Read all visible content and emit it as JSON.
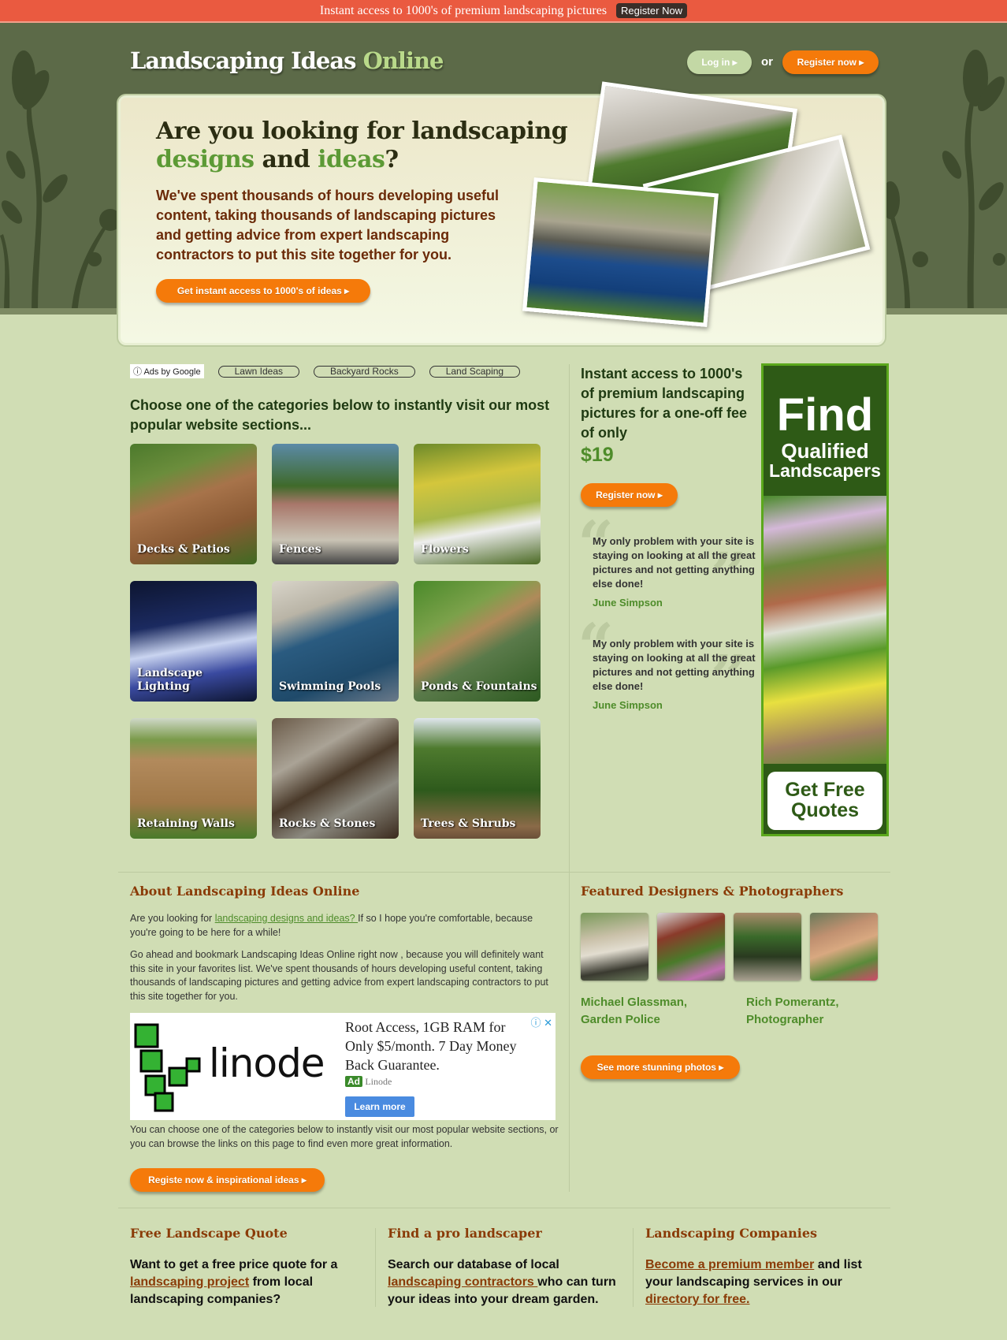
{
  "topbar": {
    "message": "Instant access to 1000's of premium landscaping pictures",
    "register": "Register Now"
  },
  "header": {
    "logo_main": "Landscaping Ideas ",
    "logo_accent": "Online",
    "login": "Log in",
    "or": "or",
    "register": "Register now"
  },
  "hero": {
    "h1_part1": "Are you looking for landscaping ",
    "h1_green1": "designs",
    "h1_and": " and ",
    "h1_green2": "ideas",
    "h1_q": "?",
    "paragraph": "We've spent thousands of hours developing useful content, taking thousands of landscaping pictures and getting advice from expert landscaping contractors to put this site together for you.",
    "cta": "Get instant access to 1000's of ideas"
  },
  "ads": {
    "label": "Ads by Google",
    "links": [
      "Lawn Ideas",
      "Backyard Rocks",
      "Land Scaping"
    ]
  },
  "categories": {
    "heading": "Choose one of the categories below to instantly visit our most popular website sections...",
    "items": [
      "Decks & Patios",
      "Fences",
      "Flowers",
      "Landscape Lighting",
      "Swimming Pools",
      "Ponds & Fountains",
      "Retaining Walls",
      "Rocks & Stones",
      "Trees & Shrubs"
    ]
  },
  "offer": {
    "text": "Instant access to 1000's of premium landscaping pictures for a one-off fee of only",
    "price": "$19",
    "register": "Register now"
  },
  "testimonials": [
    {
      "quote": "My only problem with your site is staying on looking at all the great pictures and not getting anything else done!",
      "name": "June Simpson"
    },
    {
      "quote": "My only problem with your site is staying on looking at all the great pictures and not getting anything else done!",
      "name": "June Simpson"
    }
  ],
  "banner": {
    "find": "Find",
    "qualified": "Qualified",
    "landscapers": "Landscapers",
    "quotes1": "Get Free",
    "quotes2": "Quotes"
  },
  "about": {
    "title": "About Landscaping Ideas Online",
    "p1_before": "Are you looking for ",
    "p1_link": "landscaping designs and ideas? ",
    "p1_after": "If so I hope you're comfortable, because you're going to be here for a while!",
    "p2": "Go ahead and bookmark Landscaping Ideas Online right now , because you will definitely want this site in your favorites list. We've spent thousands of hours developing useful content, taking thousands of landscaping pictures and getting advice from expert landscaping contractors to put this site together for you.",
    "p3": "You can choose one of the categories below to instantly visit our most popular website sections, or you can browse the links on this page to find even more great information.",
    "cta": "Registe now & inspirational ideas"
  },
  "ad": {
    "brand": "linode",
    "headline": "Root Access, 1GB RAM for Only $5/month. 7 Day Money Back Guarantee.",
    "badge": "Ad",
    "advertiser": "Linode",
    "button": "Learn more"
  },
  "featured": {
    "title": "Featured Designers & Photographers",
    "designer1": [
      "Michael Glassman,",
      "Garden Police"
    ],
    "designer2": [
      "Rich Pomerantz,",
      "Photographer"
    ],
    "cta": "See more stunning photos"
  },
  "footer": [
    {
      "title": "Free Landscape Quote",
      "before": "Want to get a free price quote for a ",
      "link": "landscaping project",
      "after": " from local landscaping companies?"
    },
    {
      "title": "Find a pro landscaper",
      "before": "Search our database of local ",
      "link": "landscaping contractors ",
      "after": "who can turn your ideas into your dream garden."
    },
    {
      "title": "Landscaping Companies",
      "link": "Become a premium member",
      "mid": " and list your landscaping services in our ",
      "link2": "directory for free."
    }
  ],
  "colors": {
    "accent": "#f57a0a",
    "green": "#4e8c2a",
    "brown": "#8a3b07",
    "topbar": "#ea5a40"
  }
}
